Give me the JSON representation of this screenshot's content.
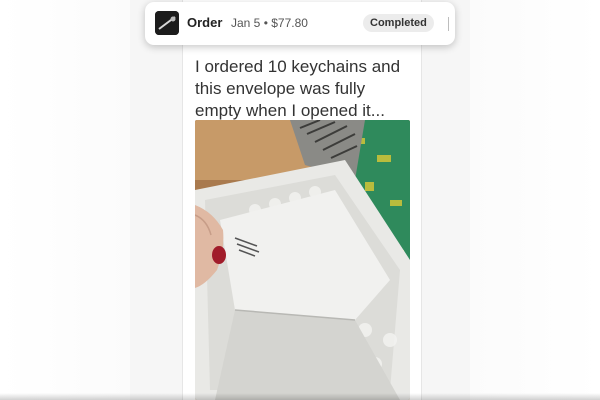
{
  "order": {
    "label": "Order",
    "meta": "Jan 5 • $77.80",
    "status": "Completed"
  },
  "post": {
    "text": "I ordered 10 keychains and this envelope was fully empty when I opened it..."
  },
  "colors": {
    "card_bg": "#ffffff",
    "badge_bg": "#ececec",
    "text": "#333333"
  },
  "icons": {
    "order_thumbnail": "product-thumbnail",
    "divider": "vertical-divider"
  }
}
